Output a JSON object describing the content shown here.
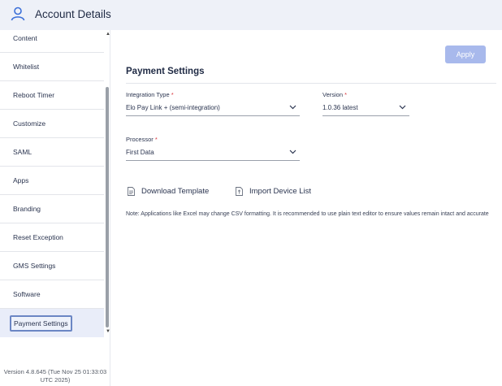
{
  "header": {
    "title": "Account Details",
    "icon": "user-icon"
  },
  "sidebar": {
    "items": [
      {
        "label": "Content"
      },
      {
        "label": "Whitelist"
      },
      {
        "label": "Reboot Timer"
      },
      {
        "label": "Customize"
      },
      {
        "label": "SAML"
      },
      {
        "label": "Apps"
      },
      {
        "label": "Branding"
      },
      {
        "label": "Reset Exception"
      },
      {
        "label": "GMS Settings"
      },
      {
        "label": "Software"
      },
      {
        "label": "Payment Settings",
        "active": true
      }
    ],
    "version": "Version 4.8.645 (Tue Nov 25 01:33:03 UTC 2025)"
  },
  "main": {
    "apply_label": "Apply",
    "section_title": "Payment Settings",
    "integration_type": {
      "label": "Integration Type",
      "required": "*",
      "value": "Elo Pay Link + (semi-integration)"
    },
    "version": {
      "label": "Version",
      "required": "*",
      "value": "1.0.36 latest"
    },
    "processor": {
      "label": "Processor",
      "required": "*",
      "value": "First Data"
    },
    "download_template_label": "Download Template",
    "import_device_list_label": "Import Device List",
    "note": "Note: Applications like Excel may change CSV formatting. It is recommended to use plain text editor to ensure values remain intact and accurate"
  },
  "colors": {
    "apply_button": "#a8b9ec",
    "active_item_bg": "#e9edf9",
    "required": "#d9343b",
    "topbar": "#eef1f8"
  }
}
